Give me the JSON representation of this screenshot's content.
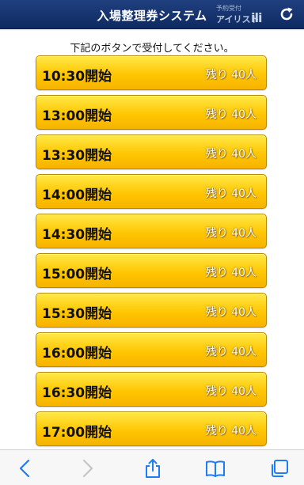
{
  "header": {
    "title": "入場整理券システム",
    "brand_sub": "予約受付",
    "brand_name": "アイリスト",
    "brand_mark": "ili"
  },
  "instruction": "下記のボタンで受付してください。",
  "slots": [
    {
      "time": "10:30開始",
      "remaining": "残り 40人"
    },
    {
      "time": "13:00開始",
      "remaining": "残り 40人"
    },
    {
      "time": "13:30開始",
      "remaining": "残り 40人"
    },
    {
      "time": "14:00開始",
      "remaining": "残り 40人"
    },
    {
      "time": "14:30開始",
      "remaining": "残り 40人"
    },
    {
      "time": "15:00開始",
      "remaining": "残り 40人"
    },
    {
      "time": "15:30開始",
      "remaining": "残り 40人"
    },
    {
      "time": "16:00開始",
      "remaining": "残り 40人"
    },
    {
      "time": "16:30開始",
      "remaining": "残り 40人"
    },
    {
      "time": "17:00開始",
      "remaining": "残り 40人"
    }
  ],
  "toolbar": {
    "icons": [
      "back-icon",
      "forward-icon",
      "share-icon",
      "bookmarks-icon",
      "tabs-icon"
    ],
    "accent_color": "#1f7cf5",
    "disabled_color": "#c4c4c4"
  },
  "colors": {
    "header_bg": "#0f2a62",
    "button_gold": "#ffc400",
    "button_border": "#b58a00"
  }
}
